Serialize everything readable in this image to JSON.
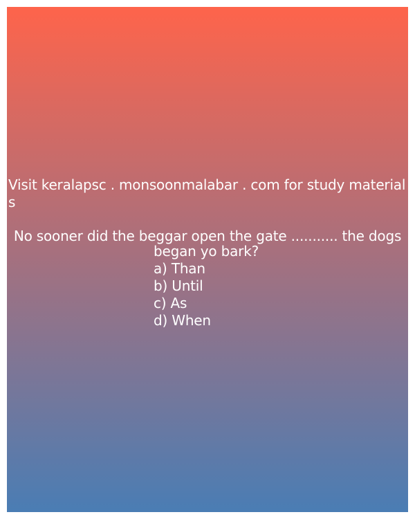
{
  "site_notice": "Visit keralapsc . monsoonmalabar . com for study materials",
  "question": {
    "line1": "No sooner did the beggar open the gate ........... the dogs",
    "line2": "began yo bark?"
  },
  "options": [
    "a) Than",
    "b) Until",
    "c) As",
    "d) When"
  ],
  "colors": {
    "gradient_top": "#fe644b",
    "gradient_bottom": "#4a7db4",
    "text": "#ffffff"
  }
}
